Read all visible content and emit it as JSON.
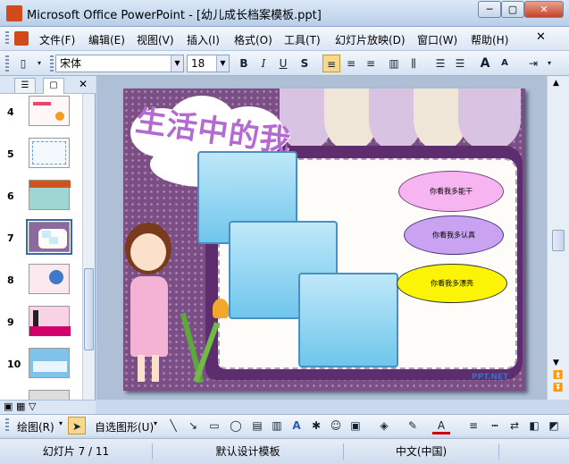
{
  "window": {
    "title": "Microsoft Office PowerPoint - [幼儿成长档案模板.ppt]",
    "minimize_label": "─",
    "restore_label": "▢",
    "close_label": "✕"
  },
  "menu": {
    "items": [
      "文件(F)",
      "编辑(E)",
      "视图(V)",
      "插入(I)",
      "格式(O)",
      "工具(T)",
      "幻灯片放映(D)",
      "窗口(W)",
      "帮助(H)"
    ]
  },
  "toolbar": {
    "font_name": "宋体",
    "font_size": "18",
    "bold": "B",
    "italic": "I",
    "underline": "U",
    "shadow": "S",
    "grow_font": "A",
    "shrink_font": "A"
  },
  "slide_panel": {
    "slides": [
      {
        "num": "4",
        "thumb_color": "#fff6f6",
        "accent": "#e8486b"
      },
      {
        "num": "5",
        "thumb_color": "#f4f8ff",
        "accent": "#6aa0d8"
      },
      {
        "num": "6",
        "thumb_color": "#9fd6d4",
        "accent": "#d0541c"
      },
      {
        "num": "7",
        "thumb_color": "#8d6a9d",
        "accent": "#c7ecfa"
      },
      {
        "num": "8",
        "thumb_color": "#fbe9ef",
        "accent": "#3f78c8"
      },
      {
        "num": "9",
        "thumb_color": "#f7d3e5",
        "accent": "#d1006a"
      },
      {
        "num": "10",
        "thumb_color": "#7fc3ea",
        "accent": "#2a62b4"
      }
    ],
    "selected": "7"
  },
  "slide": {
    "title": "生活中的我",
    "bubbles": [
      "你看我多能干",
      "你看我多认真",
      "你看我多漂亮"
    ],
    "watermark": "PPT.NET"
  },
  "draw_toolbar": {
    "draw_label": "绘图(R)",
    "autoshapes_label": "自选图形(U)"
  },
  "status": {
    "slide_pos": "幻灯片 7 / 11",
    "design": "默认设计模板",
    "language": "中文(中国)"
  },
  "colors": {
    "bubble_pink": "#f6b4f0",
    "bubble_purple": "#c9a3f2",
    "bubble_yellow": "#fbf406",
    "title_purple": "#b46ad0"
  }
}
